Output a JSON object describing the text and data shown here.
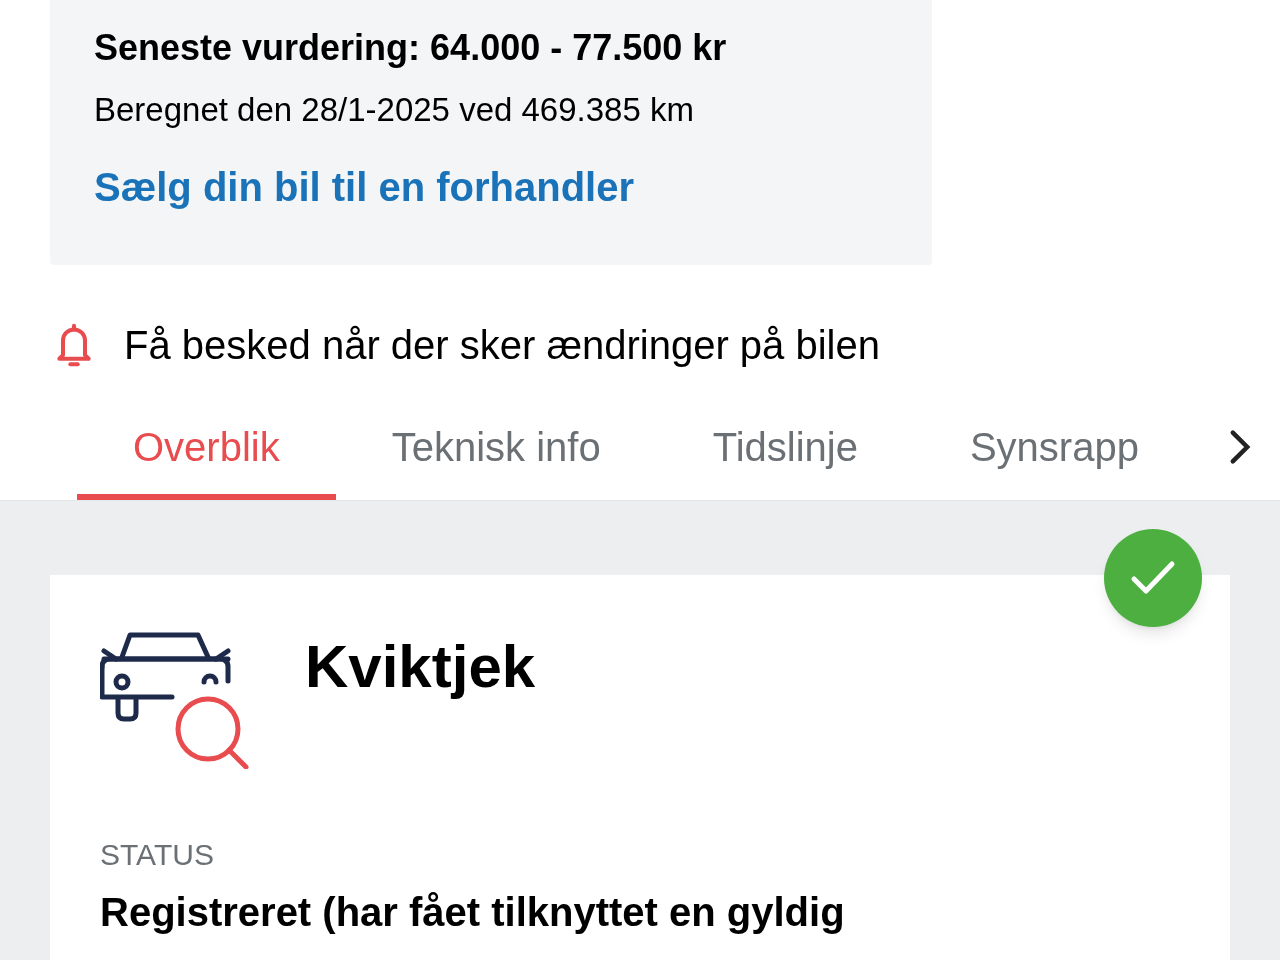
{
  "valuation": {
    "title": "Seneste vurdering: 64.000 - 77.500 kr",
    "subtitle": "Beregnet den 28/1-2025 ved 469.385 km",
    "link": "Sælg din bil til en forhandler"
  },
  "notify": {
    "label": "Få besked når der sker ændringer på bilen"
  },
  "tabs": [
    {
      "label": "Overblik",
      "selected": true
    },
    {
      "label": "Teknisk info",
      "selected": false
    },
    {
      "label": "Tidslinje",
      "selected": false
    },
    {
      "label": "Synsrapp",
      "selected": false
    }
  ],
  "card": {
    "title": "Kviktjek",
    "checked": true,
    "status_label": "STATUS",
    "status_value": "Registreret (har fået tilknyttet en gyldig"
  }
}
